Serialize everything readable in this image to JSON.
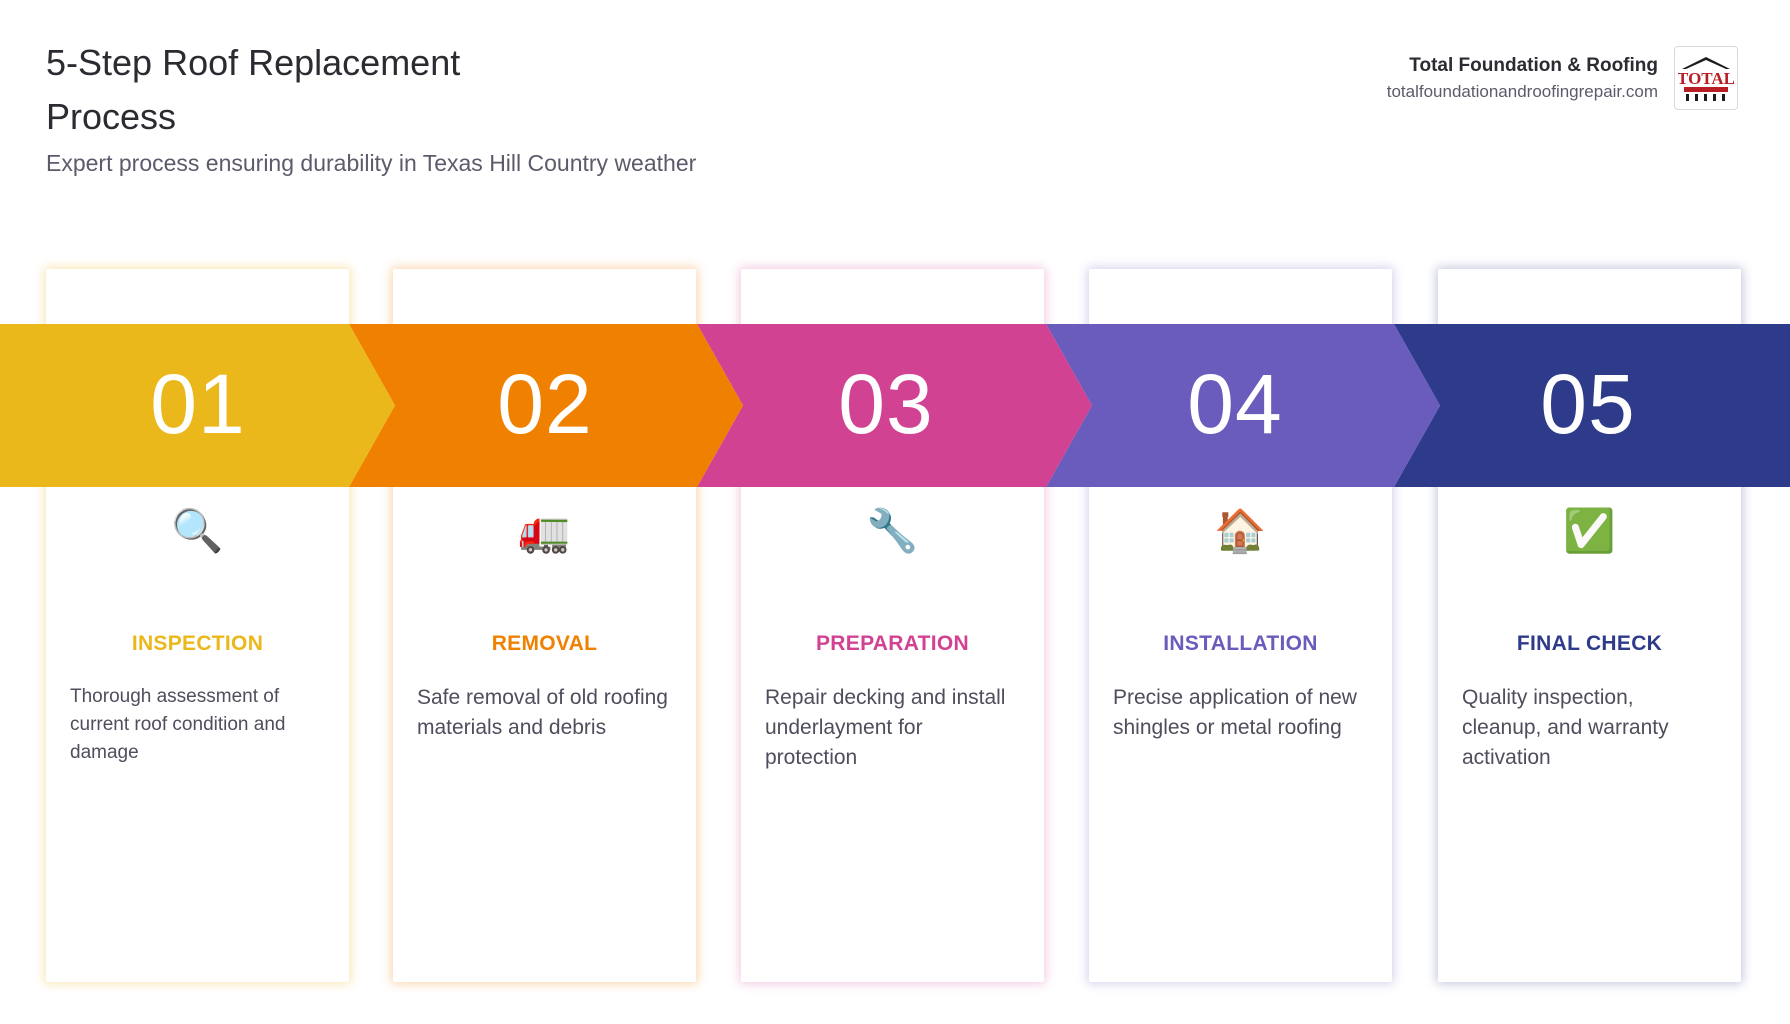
{
  "header": {
    "title": "5-Step Roof Replacement Process",
    "subtitle": "Expert process ensuring durability in Texas Hill Country weather"
  },
  "brand": {
    "name": "Total Foundation & Roofing",
    "url": "totalfoundationandroofingrepair.com",
    "logo_text": "TOTAL",
    "logo_subtext": "FOUNDATION & ROOFING"
  },
  "steps": [
    {
      "number": "01",
      "title": "INSPECTION",
      "description": "Thorough assessment of current roof condition and damage",
      "icon": "🔍",
      "icon_name": "magnifying-glass-icon",
      "color": "#EBB81B"
    },
    {
      "number": "02",
      "title": "REMOVAL",
      "description": "Safe removal of old roofing materials and debris",
      "icon": "🚛",
      "icon_name": "truck-icon",
      "color": "#F08000"
    },
    {
      "number": "03",
      "title": "PREPARATION",
      "description": "Repair decking and install underlayment for protection",
      "icon": "🔧",
      "icon_name": "wrench-icon",
      "color": "#D24293"
    },
    {
      "number": "04",
      "title": "INSTALLATION",
      "description": "Precise application of new shingles or metal roofing",
      "icon": "🏠",
      "icon_name": "house-icon",
      "color": "#6A5CBC"
    },
    {
      "number": "05",
      "title": "FINAL CHECK",
      "description": "Quality inspection, cleanup, and warranty activation",
      "icon": "✅",
      "icon_name": "check-mark-icon",
      "color": "#2E3A8A"
    }
  ]
}
